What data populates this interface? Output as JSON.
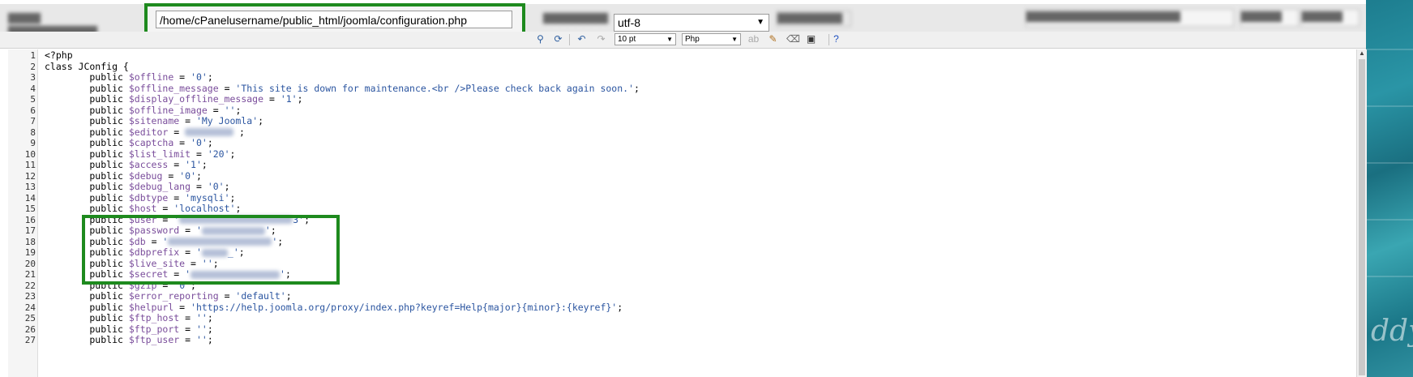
{
  "file_path": "/home/cPanelusername/public_html/joomla/configuration.php",
  "encoding": "utf-8",
  "font_size": "10 pt",
  "syntax": "Php",
  "lines": [
    {
      "n": "1",
      "parts": [
        {
          "t": "kw",
          "v": "<?php"
        }
      ]
    },
    {
      "n": "2",
      "parts": [
        {
          "t": "kw",
          "v": "class JConfig {"
        }
      ]
    },
    {
      "n": "3",
      "parts": [
        {
          "t": "kw",
          "v": "        public "
        },
        {
          "t": "var",
          "v": "$offline"
        },
        {
          "t": "op",
          "v": " = "
        },
        {
          "t": "str",
          "v": "'0'"
        },
        {
          "t": "op",
          "v": ";"
        }
      ]
    },
    {
      "n": "4",
      "parts": [
        {
          "t": "kw",
          "v": "        public "
        },
        {
          "t": "var",
          "v": "$offline_message"
        },
        {
          "t": "op",
          "v": " = "
        },
        {
          "t": "str",
          "v": "'This site is down for maintenance.<br />Please check back again soon.'"
        },
        {
          "t": "op",
          "v": ";"
        }
      ]
    },
    {
      "n": "5",
      "parts": [
        {
          "t": "kw",
          "v": "        public "
        },
        {
          "t": "var",
          "v": "$display_offline_message"
        },
        {
          "t": "op",
          "v": " = "
        },
        {
          "t": "str",
          "v": "'1'"
        },
        {
          "t": "op",
          "v": ";"
        }
      ]
    },
    {
      "n": "6",
      "parts": [
        {
          "t": "kw",
          "v": "        public "
        },
        {
          "t": "var",
          "v": "$offline_image"
        },
        {
          "t": "op",
          "v": " = "
        },
        {
          "t": "str",
          "v": "''"
        },
        {
          "t": "op",
          "v": ";"
        }
      ]
    },
    {
      "n": "7",
      "parts": [
        {
          "t": "kw",
          "v": "        public "
        },
        {
          "t": "var",
          "v": "$sitename"
        },
        {
          "t": "op",
          "v": " = "
        },
        {
          "t": "str",
          "v": "'My Joomla'"
        },
        {
          "t": "op",
          "v": ";"
        }
      ]
    },
    {
      "n": "8",
      "parts": [
        {
          "t": "kw",
          "v": "        public "
        },
        {
          "t": "var",
          "v": "$editor"
        },
        {
          "t": "op",
          "v": " = "
        },
        {
          "t": "mask",
          "v": "60"
        },
        {
          "t": "op",
          "v": " ;"
        }
      ]
    },
    {
      "n": "9",
      "parts": [
        {
          "t": "kw",
          "v": "        public "
        },
        {
          "t": "var",
          "v": "$captcha"
        },
        {
          "t": "op",
          "v": " = "
        },
        {
          "t": "str",
          "v": "'0'"
        },
        {
          "t": "op",
          "v": ";"
        }
      ]
    },
    {
      "n": "10",
      "parts": [
        {
          "t": "kw",
          "v": "        public "
        },
        {
          "t": "var",
          "v": "$list_limit"
        },
        {
          "t": "op",
          "v": " = "
        },
        {
          "t": "str",
          "v": "'20'"
        },
        {
          "t": "op",
          "v": ";"
        }
      ]
    },
    {
      "n": "11",
      "parts": [
        {
          "t": "kw",
          "v": "        public "
        },
        {
          "t": "var",
          "v": "$access"
        },
        {
          "t": "op",
          "v": " = "
        },
        {
          "t": "str",
          "v": "'1'"
        },
        {
          "t": "op",
          "v": ";"
        }
      ]
    },
    {
      "n": "12",
      "parts": [
        {
          "t": "kw",
          "v": "        public "
        },
        {
          "t": "var",
          "v": "$debug"
        },
        {
          "t": "op",
          "v": " = "
        },
        {
          "t": "str",
          "v": "'0'"
        },
        {
          "t": "op",
          "v": ";"
        }
      ]
    },
    {
      "n": "13",
      "parts": [
        {
          "t": "kw",
          "v": "        public "
        },
        {
          "t": "var",
          "v": "$debug_lang"
        },
        {
          "t": "op",
          "v": " = "
        },
        {
          "t": "str",
          "v": "'0'"
        },
        {
          "t": "op",
          "v": ";"
        }
      ]
    },
    {
      "n": "14",
      "parts": [
        {
          "t": "kw",
          "v": "        public "
        },
        {
          "t": "var",
          "v": "$dbtype"
        },
        {
          "t": "op",
          "v": " = "
        },
        {
          "t": "str",
          "v": "'mysqli'"
        },
        {
          "t": "op",
          "v": ";"
        }
      ]
    },
    {
      "n": "15",
      "parts": [
        {
          "t": "kw",
          "v": "        public "
        },
        {
          "t": "var",
          "v": "$host"
        },
        {
          "t": "op",
          "v": " = "
        },
        {
          "t": "str",
          "v": "'localhost'"
        },
        {
          "t": "op",
          "v": ";"
        }
      ]
    },
    {
      "n": "16",
      "parts": [
        {
          "t": "kw",
          "v": "        public "
        },
        {
          "t": "var",
          "v": "$user"
        },
        {
          "t": "op",
          "v": " = "
        },
        {
          "t": "str",
          "v": "'"
        },
        {
          "t": "mask",
          "v": "140"
        },
        {
          "t": "str",
          "v": "3'"
        },
        {
          "t": "op",
          "v": ";"
        }
      ]
    },
    {
      "n": "17",
      "parts": [
        {
          "t": "kw",
          "v": "        public "
        },
        {
          "t": "var",
          "v": "$password"
        },
        {
          "t": "op",
          "v": " = "
        },
        {
          "t": "str",
          "v": "'"
        },
        {
          "t": "mask",
          "v": "78"
        },
        {
          "t": "str",
          "v": "'"
        },
        {
          "t": "op",
          "v": ";"
        }
      ]
    },
    {
      "n": "18",
      "parts": [
        {
          "t": "kw",
          "v": "        public "
        },
        {
          "t": "var",
          "v": "$db"
        },
        {
          "t": "op",
          "v": " = "
        },
        {
          "t": "str",
          "v": "'"
        },
        {
          "t": "mask",
          "v": "128"
        },
        {
          "t": "str",
          "v": "'"
        },
        {
          "t": "op",
          "v": ";"
        }
      ]
    },
    {
      "n": "19",
      "parts": [
        {
          "t": "kw",
          "v": "        public "
        },
        {
          "t": "var",
          "v": "$dbprefix"
        },
        {
          "t": "op",
          "v": " = "
        },
        {
          "t": "str",
          "v": "'"
        },
        {
          "t": "mask",
          "v": "32"
        },
        {
          "t": "str",
          "v": "_'"
        },
        {
          "t": "op",
          "v": ";"
        }
      ]
    },
    {
      "n": "20",
      "parts": [
        {
          "t": "kw",
          "v": "        public "
        },
        {
          "t": "var",
          "v": "$live_site"
        },
        {
          "t": "op",
          "v": " = "
        },
        {
          "t": "str",
          "v": "''"
        },
        {
          "t": "op",
          "v": ";"
        }
      ]
    },
    {
      "n": "21",
      "parts": [
        {
          "t": "kw",
          "v": "        public "
        },
        {
          "t": "var",
          "v": "$secret"
        },
        {
          "t": "op",
          "v": " = "
        },
        {
          "t": "str",
          "v": "'"
        },
        {
          "t": "mask",
          "v": "110"
        },
        {
          "t": "str",
          "v": "'"
        },
        {
          "t": "op",
          "v": ";"
        }
      ]
    },
    {
      "n": "22",
      "parts": [
        {
          "t": "kw",
          "v": "        public "
        },
        {
          "t": "var",
          "v": "$gzip"
        },
        {
          "t": "op",
          "v": " = "
        },
        {
          "t": "str",
          "v": "'0'"
        },
        {
          "t": "op",
          "v": ";"
        }
      ]
    },
    {
      "n": "23",
      "parts": [
        {
          "t": "kw",
          "v": "        public "
        },
        {
          "t": "var",
          "v": "$error_reporting"
        },
        {
          "t": "op",
          "v": " = "
        },
        {
          "t": "str",
          "v": "'default'"
        },
        {
          "t": "op",
          "v": ";"
        }
      ]
    },
    {
      "n": "24",
      "parts": [
        {
          "t": "kw",
          "v": "        public "
        },
        {
          "t": "var",
          "v": "$helpurl"
        },
        {
          "t": "op",
          "v": " = "
        },
        {
          "t": "str",
          "v": "'https://help.joomla.org/proxy/index.php?keyref=Help{major}{minor}:{keyref}'"
        },
        {
          "t": "op",
          "v": ";"
        }
      ]
    },
    {
      "n": "25",
      "parts": [
        {
          "t": "kw",
          "v": "        public "
        },
        {
          "t": "var",
          "v": "$ftp_host"
        },
        {
          "t": "op",
          "v": " = "
        },
        {
          "t": "str",
          "v": "''"
        },
        {
          "t": "op",
          "v": ";"
        }
      ]
    },
    {
      "n": "26",
      "parts": [
        {
          "t": "kw",
          "v": "        public "
        },
        {
          "t": "var",
          "v": "$ftp_port"
        },
        {
          "t": "op",
          "v": " = "
        },
        {
          "t": "str",
          "v": "''"
        },
        {
          "t": "op",
          "v": ";"
        }
      ]
    },
    {
      "n": "27",
      "parts": [
        {
          "t": "kw",
          "v": "        public "
        },
        {
          "t": "var",
          "v": "$ftp_user"
        },
        {
          "t": "op",
          "v": " = "
        },
        {
          "t": "str",
          "v": "''"
        },
        {
          "t": "op",
          "v": ";"
        }
      ]
    }
  ],
  "colors": {
    "highlight": "#1e8a1e",
    "variable": "#7a4d9b",
    "string": "#2b55a0"
  },
  "icons": [
    "binoculars-icon",
    "refresh-icon",
    "undo-icon",
    "redo-icon",
    "spellcheck-icon",
    "brush-icon",
    "eraser-icon",
    "save-icon",
    "help-icon"
  ]
}
